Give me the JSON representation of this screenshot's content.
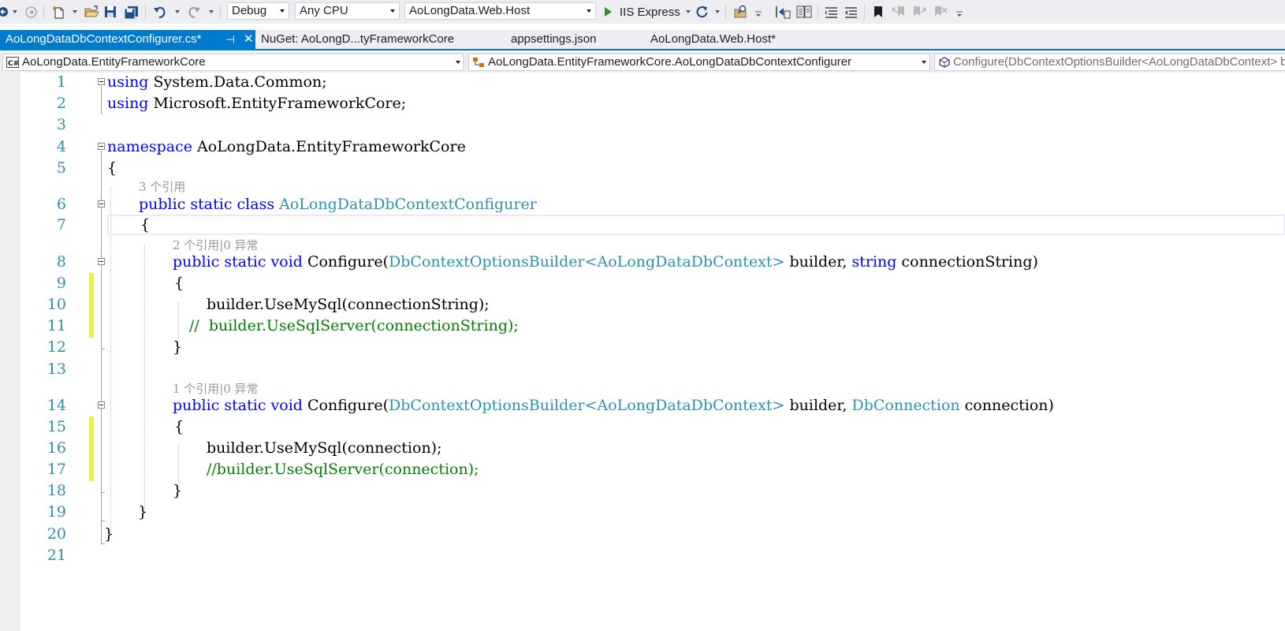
{
  "toolbar": {
    "configuration": "Debug",
    "platform": "Any CPU",
    "startup_project": "AoLongData.Web.Host",
    "run_label": "IIS Express"
  },
  "tabs": [
    {
      "label": "AoLongDataDbContextConfigurer.cs*",
      "active": true
    },
    {
      "label": "NuGet: AoLongD...tyFrameworkCore",
      "active": false
    },
    {
      "label": "appsettings.json",
      "active": false
    },
    {
      "label": "AoLongData.Web.Host*",
      "active": false
    }
  ],
  "tab_pin_glyph": "⊣",
  "tab_close_glyph": "✕",
  "navbar": {
    "project": "AoLongData.EntityFrameworkCore",
    "type": "AoLongData.EntityFrameworkCore.AoLongDataDbContextConfigurer",
    "member": "Configure(DbContextOptionsBuilder<AoLongDataDbContext> builder, string connectionString)"
  },
  "line_numbers": [
    "1",
    "2",
    "3",
    "4",
    "5",
    "6",
    "7",
    "8",
    "9",
    "10",
    "11",
    "12",
    "13",
    "14",
    "15",
    "16",
    "17",
    "18",
    "19",
    "20",
    "21"
  ],
  "code": {
    "l1": {
      "kw": "using",
      "rest": " System.Data.Common;"
    },
    "l2": {
      "kw": "using",
      "rest": " Microsoft.EntityFrameworkCore;"
    },
    "l4": {
      "kw": "namespace",
      "rest": " AoLongData.EntityFrameworkCore"
    },
    "l5": "{",
    "lens6": "3 个引用",
    "l6": {
      "kw1": "public",
      "kw2": "static",
      "kw3": "class",
      "type": "AoLongDataDbContextConfigurer"
    },
    "l7": "{",
    "lens8": "2 个引用|0 异常",
    "l8": {
      "kw1": "public",
      "kw2": "static",
      "kw3": "void",
      "name": "Configure(",
      "type1": "DbContextOptionsBuilder",
      "lt": "<",
      "type2": "AoLongDataDbContext",
      "gt": ">",
      "p1": " builder, ",
      "kw4": "string",
      "p2": " connectionString)"
    },
    "l9": "{",
    "l10": "builder.UseMySql(connectionString);",
    "l11": "//  builder.UseSqlServer(connectionString);",
    "l12": "}",
    "lens14": "1 个引用|0 异常",
    "l14": {
      "kw1": "public",
      "kw2": "static",
      "kw3": "void",
      "name": "Configure(",
      "type1": "DbContextOptionsBuilder",
      "lt": "<",
      "type2": "AoLongDataDbContext",
      "gt": ">",
      "p1": " builder, ",
      "type3": "DbConnection",
      "p2": " connection)"
    },
    "l15": "{",
    "l16": "builder.UseMySql(connection);",
    "l17": "//builder.UseSqlServer(connection);",
    "l18": "}",
    "l19": "}",
    "l20": "}"
  },
  "colors": {
    "keyword": "#0000ff",
    "type": "#2b91af",
    "comment": "#008000",
    "line_number": "#2b91af",
    "accent": "#007acc",
    "change_marker": "#efef48"
  },
  "icons": [
    "back-icon",
    "forward-icon",
    "new-item-icon",
    "open-file-icon",
    "save-icon",
    "save-all-icon",
    "undo-icon",
    "redo-icon",
    "start-debug-icon",
    "refresh-icon",
    "find-in-files-icon",
    "step-icon",
    "comment-icon",
    "uncomment-icon",
    "bookmark-icon",
    "prev-bookmark-icon",
    "next-bookmark-icon",
    "clear-bookmarks-icon",
    "csharp-project-icon",
    "class-icon",
    "method-icon"
  ]
}
